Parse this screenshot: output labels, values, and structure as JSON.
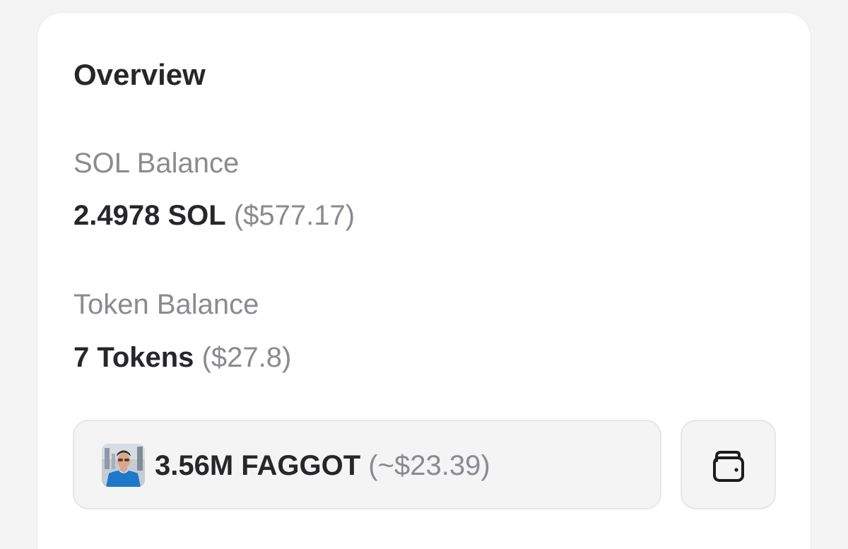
{
  "overview": {
    "title": "Overview",
    "sol": {
      "label": "SOL Balance",
      "amount": "2.4978 SOL",
      "usd": "($577.17)"
    },
    "tokens": {
      "label": "Token Balance",
      "count": "7 Tokens",
      "usd": "($27.8)"
    },
    "holding": {
      "amount": "3.56M FAGGOT",
      "usd": "(~$23.39)",
      "avatar_icon": "token-avatar"
    },
    "wallet_button": {
      "icon": "wallet-icon"
    }
  },
  "colors": {
    "text_primary": "#27272a",
    "text_muted": "#8a8a90",
    "card_bg": "#ffffff",
    "chip_bg": "#f4f4f5"
  }
}
